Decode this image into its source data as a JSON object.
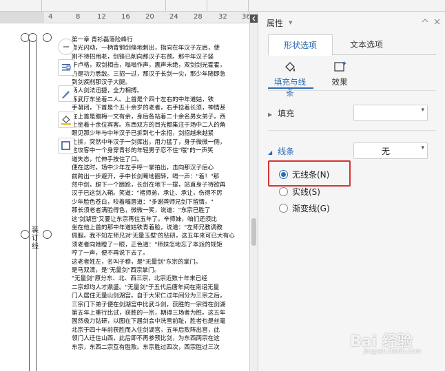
{
  "ruler": {
    "ticks": [
      "4",
      "8",
      "12",
      "16",
      "20",
      "24",
      "28",
      "32",
      "36"
    ]
  },
  "gutter": {
    "label": "装\n订\n线"
  },
  "document": {
    "lines": [
      "第一章  青衫磊落险峰行",
      "  青光闪动，一柄青钢剑倏地刺出，指向在年汉子左肩，使",
      "刚不待招用老，剑锋已削向那汉子右颈。那中年汉子竖",
      "于卢格，双剑相击，嗡嗡作声，震声未绝，双剑剑光霍霍，",
      "仍是功力悉敌。三招一过，那汉子长剑一尖，那少年随即急",
      "到剑疾削那汉子大腿。",
      "  两人剑法迅捷，全力相搏。",
      "  练武厅东坐着二人。上首是个四十左右的中年道姑，铁",
      "手凝闭，下首是个五十余岁的老者，右手捻着长须，神情甚",
      "在上首是腊梅一文有余，身后各站着二十余名男女弟子。西",
      "上坐着十余位宾客。东西双方的目光都集注于场中二人的角",
      "  眼见那少年与中年汉子已拆到七十余招，剑招越来越紧",
      "上拆，突然中年汉子一剑挥出，用力猛了，身子微微一侧，",
      "这攻客中一个身穿青衫的年轻男子忍不住\"嗤\"的一声笑",
      "道失态，忙伸手按住了口。",
      "  便在这时，场中少年左手呼一掌拍出，击向那汉子后心",
      "前跨出一步避开，手中长剑蓦地圈转，喝一声：\"着！\"那",
      "然中剑，腿下一个踉跄，长剑在地下一撑，站直身子待欲再",
      "汉子已这剑入鞘。笑道：\"褚师弟，承让、承让，伤得不厉",
      "少年脸色苍白，咬着嘴唇道：\"多谢龚师兄剑下留情。\"",
      "  那长须老者满脸得色，微微一笑，说道：\"东宗已胜了",
      "这'剑湖宫'又要让东宗再住五年了。辛师妹，咱们还须比",
      "坐在他上首的那中年道姑铁青着脸，说道：\"左师兄教调教",
      "佩服。我不知左师兄对'无量玉壁'的钻研，这五年来可已大有心",
      "须老者向她瞪了一眼，正色道：\"师妹怎地忘了本派的规矩",
      "哼了一声，便不再说下去了。",
      "  这老者姓左，名叫子穆，是\"无量剑\"东宗的掌门。",
      "是马双清，是\"无量剑\"西宗掌门。",
      "  \"无量剑\"原分东、北、西三宗，北宗近数十年来已经",
      "二宗却均人才鼎盛。\"无量剑\"于五代后唐年间在南诏无量",
      "门人居住无量山剑湖宫。自于大宋仁过年间分为三宗之后，",
      "三宗门下弟子便在剑湖宫中比武斗剑，获胜的一宗得在剑湖",
      "第五年上重行比试，获胜的一宗，期得三场者为胜。这五年",
      "固然极力钻研，以图在下届剑会中洗雪前耻，胜者也是丝毫",
      "北宗于四十年前获胜而入住剑湖宫，五年后败阵出宫，此",
      "领门人迁住山西，此后即不再参预比剑，为东西两宗在这",
      "东宗，东西二宗互有胜败。东宗胜过四次，西宗胜过三次"
    ]
  },
  "panel": {
    "title": "属性",
    "tabs": [
      "形状选项",
      "文本选项"
    ],
    "subtabs": [
      "填充与线条",
      "效果"
    ],
    "fill": {
      "label": "填充",
      "value": ""
    },
    "line": {
      "label": "线条",
      "value": "无"
    },
    "options": [
      "无线条(N)",
      "实线(S)",
      "渐变线(G)"
    ],
    "selected_option": "无线条(N)"
  },
  "watermark": {
    "text": "Bai 经验",
    "sub": "jingyan.baidu.com"
  },
  "colors": {
    "accent": "#2b6ab3",
    "highlight": "#d63232"
  }
}
